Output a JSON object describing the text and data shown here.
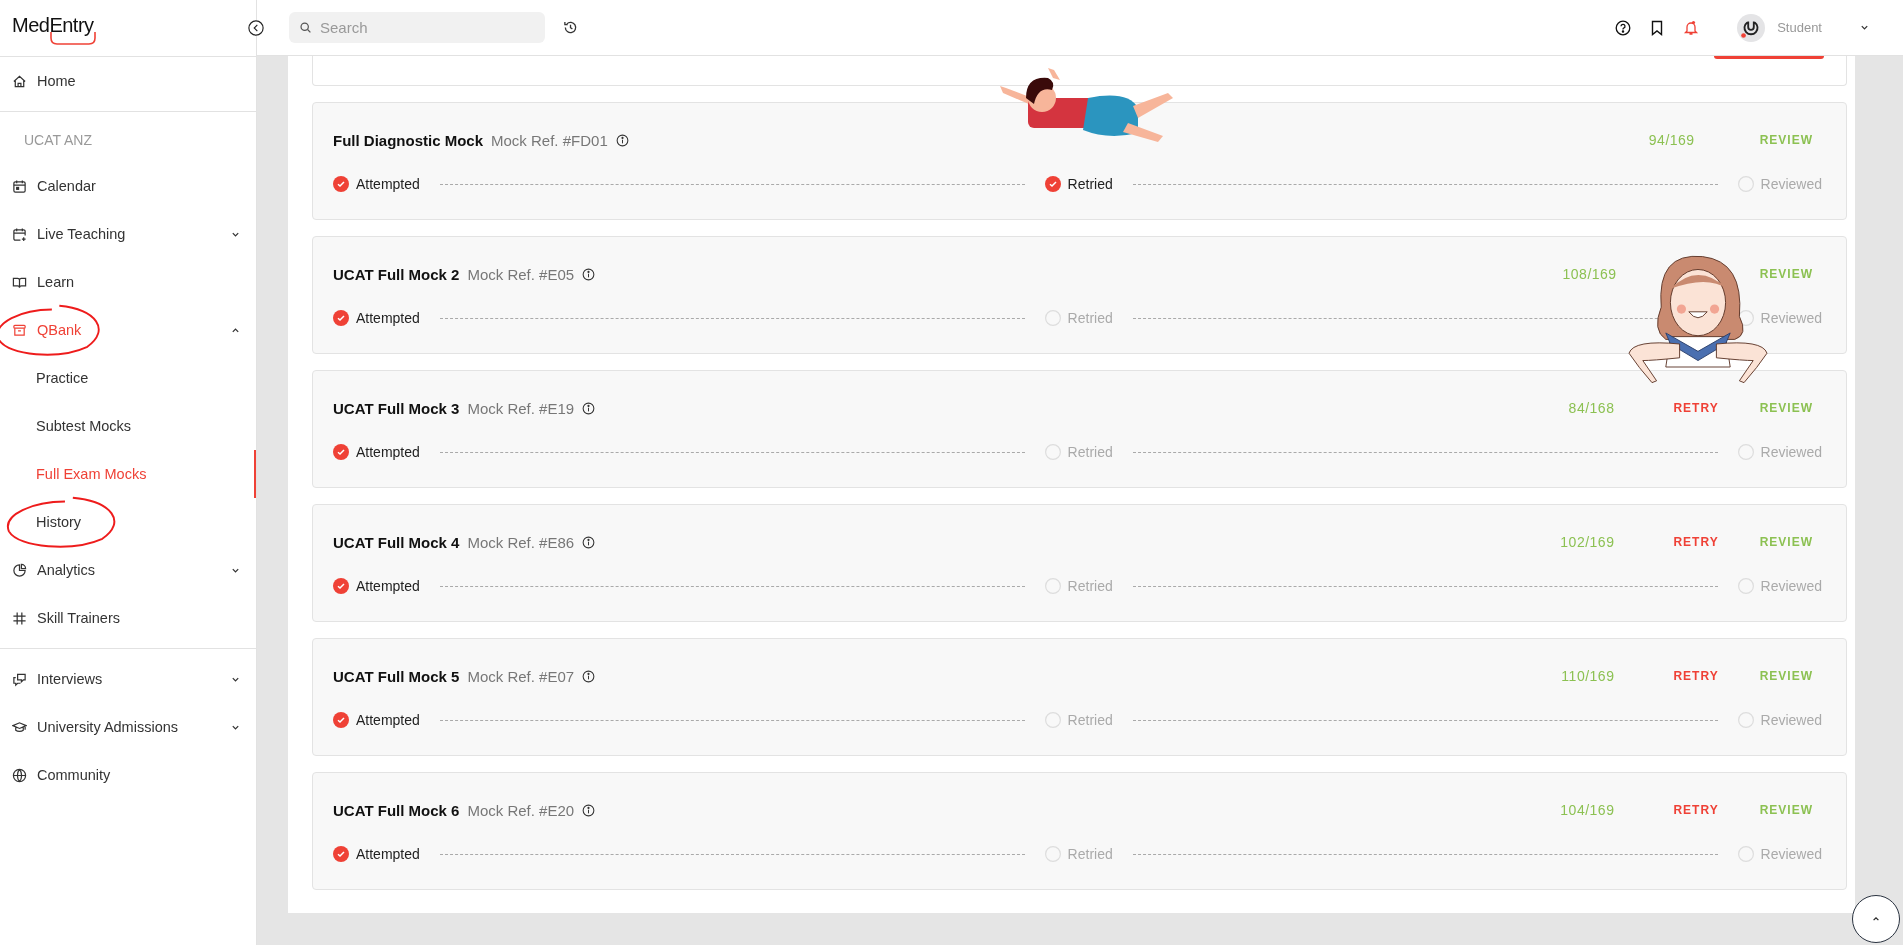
{
  "logo": {
    "text": "MedEntry"
  },
  "sidebar": {
    "items": [
      {
        "kind": "item",
        "label": "Home",
        "selected": false
      },
      {
        "kind": "divider"
      },
      {
        "kind": "section",
        "label": "UCAT ANZ"
      },
      {
        "kind": "item",
        "label": "Calendar",
        "selected": false
      },
      {
        "kind": "item",
        "label": "Live Teaching",
        "selected": false,
        "expanded": false
      },
      {
        "kind": "item",
        "label": "Learn",
        "selected": false
      },
      {
        "kind": "item",
        "label": "QBank",
        "selected": true,
        "expanded": true,
        "circled": true
      },
      {
        "kind": "subitem",
        "label": "Practice",
        "selected": false
      },
      {
        "kind": "subitem",
        "label": "Subtest Mocks",
        "selected": false
      },
      {
        "kind": "subitem",
        "label": "Full Exam Mocks",
        "selected": true
      },
      {
        "kind": "subitem",
        "label": "History",
        "selected": false,
        "circled": true
      },
      {
        "kind": "item",
        "label": "Analytics",
        "selected": false,
        "expanded": false
      },
      {
        "kind": "item",
        "label": "Skill Trainers",
        "selected": false
      },
      {
        "kind": "divider"
      },
      {
        "kind": "item",
        "label": "Interviews",
        "selected": false,
        "expanded": false
      },
      {
        "kind": "item",
        "label": "University Admissions",
        "selected": false,
        "expanded": false
      },
      {
        "kind": "item",
        "label": "Community",
        "selected": false
      }
    ]
  },
  "topbar": {
    "search": {
      "placeholder": "Search"
    },
    "user": {
      "name": "Student"
    }
  },
  "mocks": [
    {
      "title": "Full Diagnostic Mock",
      "ref": "Mock Ref. #FD01",
      "score": "94/169",
      "review": "REVIEW",
      "steps": [
        {
          "label": "Attempted",
          "done": true
        },
        {
          "label": "Retried",
          "done": true
        },
        {
          "label": "Reviewed",
          "done": false
        }
      ]
    },
    {
      "title": "UCAT Full Mock 2",
      "ref": "Mock Ref. #E05",
      "score": "108/169",
      "review": "REVIEW",
      "steps": [
        {
          "label": "Attempted",
          "done": true
        },
        {
          "label": "Retried",
          "done": false
        },
        {
          "label": "Reviewed",
          "done": false
        }
      ]
    },
    {
      "title": "UCAT Full Mock 3",
      "ref": "Mock Ref. #E19",
      "score": "84/168",
      "retry": "RETRY",
      "review": "REVIEW",
      "steps": [
        {
          "label": "Attempted",
          "done": true
        },
        {
          "label": "Retried",
          "done": false
        },
        {
          "label": "Reviewed",
          "done": false
        }
      ]
    },
    {
      "title": "UCAT Full Mock 4",
      "ref": "Mock Ref. #E86",
      "score": "102/169",
      "retry": "RETRY",
      "review": "REVIEW",
      "steps": [
        {
          "label": "Attempted",
          "done": true
        },
        {
          "label": "Retried",
          "done": false
        },
        {
          "label": "Reviewed",
          "done": false
        }
      ]
    },
    {
      "title": "UCAT Full Mock 5",
      "ref": "Mock Ref. #E07",
      "score": "110/169",
      "retry": "RETRY",
      "review": "REVIEW",
      "steps": [
        {
          "label": "Attempted",
          "done": true
        },
        {
          "label": "Retried",
          "done": false
        },
        {
          "label": "Reviewed",
          "done": false
        }
      ]
    },
    {
      "title": "UCAT Full Mock 6",
      "ref": "Mock Ref. #E20",
      "score": "104/169",
      "retry": "RETRY",
      "review": "REVIEW",
      "steps": [
        {
          "label": "Attempted",
          "done": true
        },
        {
          "label": "Retried",
          "done": false
        },
        {
          "label": "Reviewed",
          "done": false
        }
      ]
    }
  ]
}
